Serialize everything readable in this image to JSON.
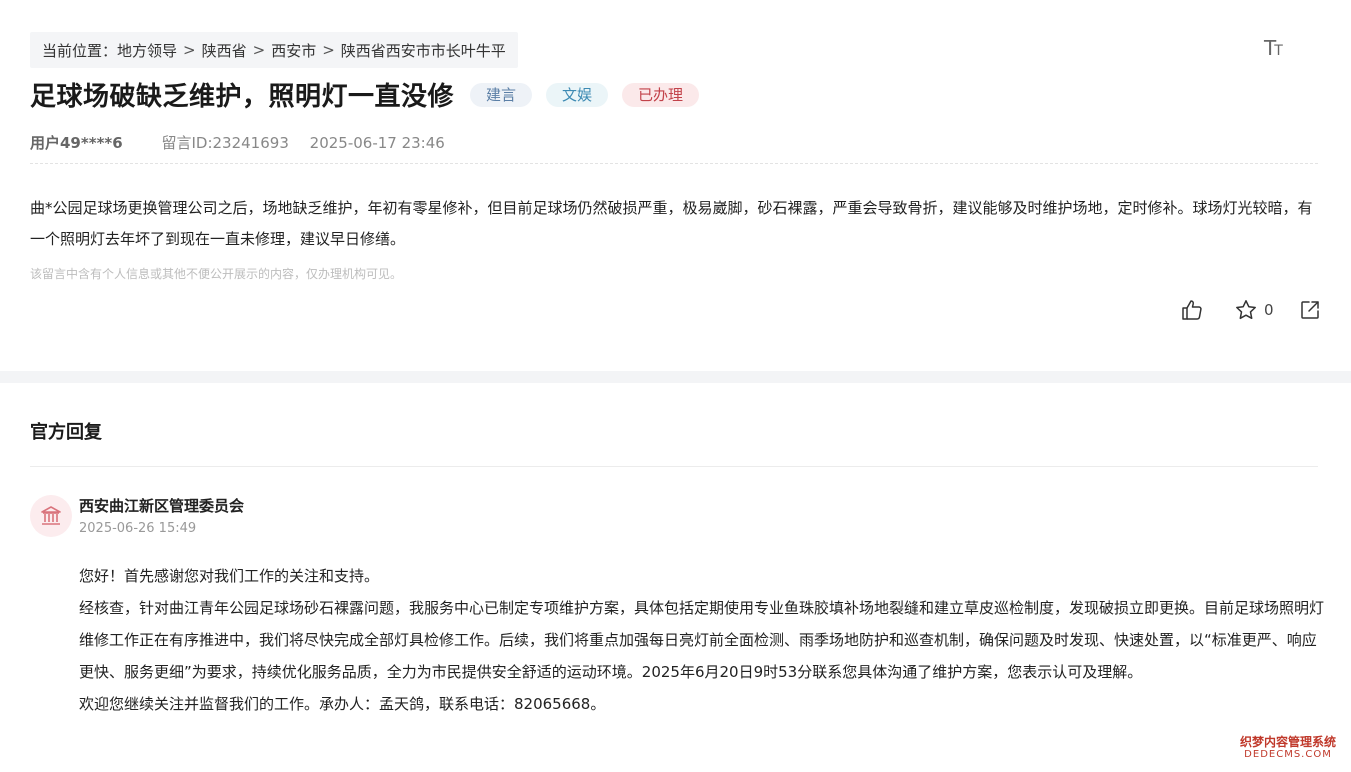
{
  "breadcrumb": {
    "prefix": "当前位置：",
    "items": [
      "地方领导",
      "陕西省",
      "西安市",
      "陕西省西安市市长叶牛平"
    ],
    "separator": ">"
  },
  "toolbar": {
    "font_size_label": "Tт",
    "font_size_icon": "font-size-icon"
  },
  "post": {
    "title": "足球场破缺乏维护，照明灯一直没修",
    "tags": [
      "建言",
      "文娱",
      "已办理"
    ],
    "user": "用户49****6",
    "message_id": "留言ID:23241693",
    "datetime": "2025-06-17 23:46",
    "body": "曲*公园足球场更换管理公司之后，场地缺乏维护，年初有零星修补，但目前足球场仍然破损严重，极易崴脚，砂石裸露，严重会导致骨折，建议能够及时维护场地，定时修补。球场灯光较暗，有一个照明灯去年坏了到现在一直未修理，建议早日修缮。",
    "privacy_notice": "该留言中含有个人信息或其他不便公开展示的内容，仅办理机构可见。",
    "favorite_count": "0"
  },
  "reply": {
    "heading": "官方回复",
    "org_name": "西安曲江新区管理委员会",
    "org_datetime": "2025-06-26 15:49",
    "paragraphs": [
      "您好！首先感谢您对我们工作的关注和支持。",
      "经核查，针对曲江青年公园足球场砂石裸露问题，我服务中心已制定专项维护方案，具体包括定期使用专业鱼珠胶填补场地裂缝和建立草皮巡检制度，发现破损立即更换。目前足球场照明灯维修工作正在有序推进中，我们将尽快完成全部灯具检修工作。后续，我们将重点加强每日亮灯前全面检测、雨季场地防护和巡查机制，确保问题及时发现、快速处置，以“标准更严、响应更快、服务更细”为要求，持续优化服务品质，全力为市民提供安全舒适的运动环境。2025年6月20日9时53分联系您具体沟通了维护方案，您表示认可及理解。",
      "欢迎您继续关注并监督我们的工作。承办人：孟天鸽，联系电话：82065668。"
    ]
  },
  "watermark": {
    "line1": "织梦内容管理系统",
    "line2": "DEDECMS.COM"
  },
  "colors": {
    "tag_suggestion": "#5b7fa6",
    "tag_culture": "#3d8ab3",
    "tag_done": "#c2424a",
    "org_icon": "#d9737c"
  }
}
